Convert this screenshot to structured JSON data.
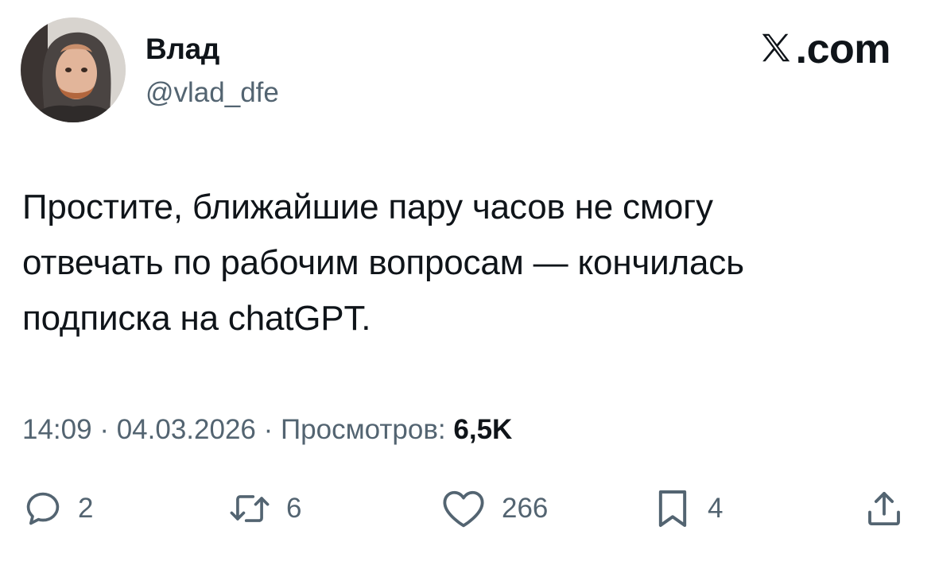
{
  "author": {
    "name": "Влад",
    "handle": "@vlad_dfe"
  },
  "brand": {
    "text": ".com",
    "icon": "x-logo-icon"
  },
  "tweet": {
    "text": "Простите, ближайшие пару часов не смогу\nотвечать по рабочим вопросам — кончилась\nподписка на chatGPT."
  },
  "meta": {
    "time": "14:09",
    "separator": "·",
    "date": "04.03.2026",
    "views_label": "Просмотров:",
    "views_count": "6,5K"
  },
  "actions": {
    "reply": {
      "icon": "reply-icon",
      "count": "2"
    },
    "repost": {
      "icon": "repost-icon",
      "count": "6"
    },
    "like": {
      "icon": "heart-icon",
      "count": "266"
    },
    "bookmark": {
      "icon": "bookmark-icon",
      "count": "4"
    },
    "share": {
      "icon": "share-icon"
    }
  },
  "colors": {
    "text_primary": "#0f1419",
    "text_secondary": "#536471",
    "background": "#ffffff"
  }
}
